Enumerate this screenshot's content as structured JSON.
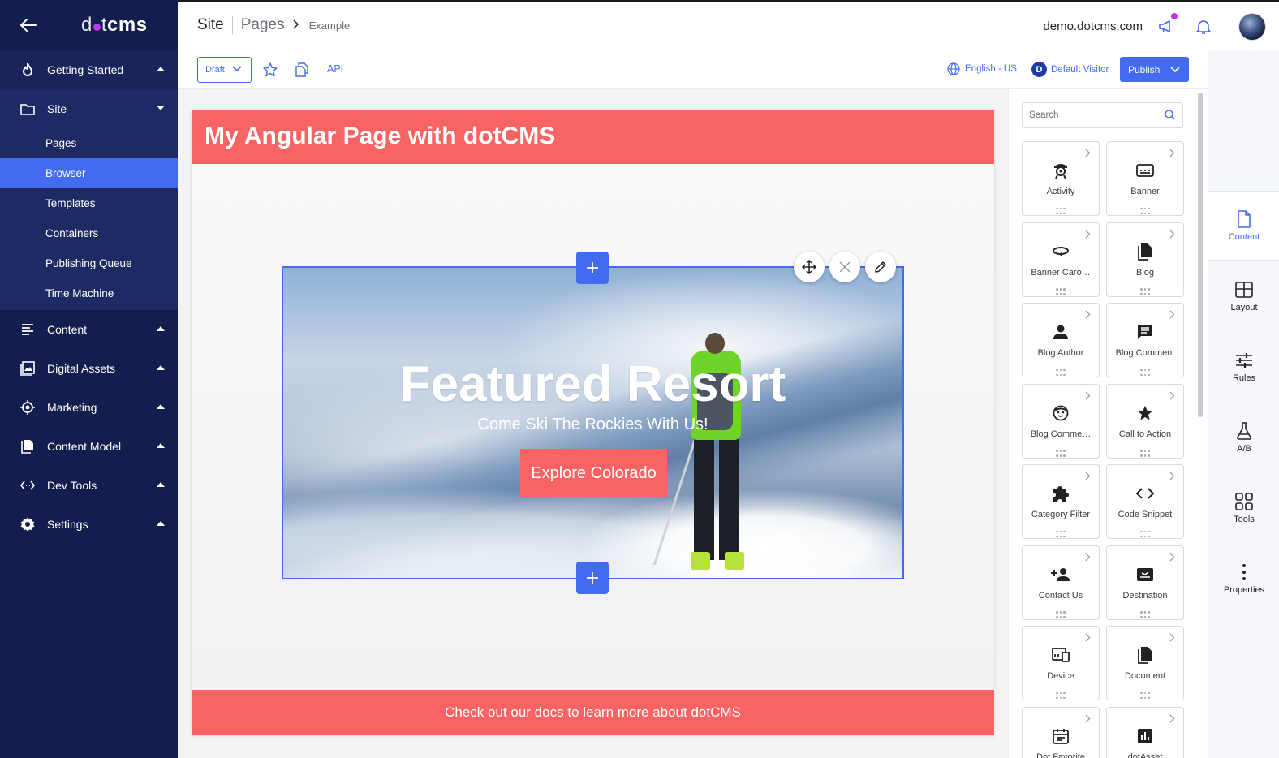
{
  "sidebar": {
    "logo_prefix": "d",
    "logo_dot_text": "t",
    "logo_cms": "cms",
    "groups": [
      {
        "label": "Getting Started",
        "icon": "flame-icon"
      },
      {
        "label": "Site",
        "icon": "folder-icon"
      },
      {
        "label": "Content",
        "icon": "content-lines-icon"
      },
      {
        "label": "Digital Assets",
        "icon": "image-icon"
      },
      {
        "label": "Marketing",
        "icon": "target-icon"
      },
      {
        "label": "Content Model",
        "icon": "documents-icon"
      },
      {
        "label": "Dev Tools",
        "icon": "code-arrows-icon"
      },
      {
        "label": "Settings",
        "icon": "gear-icon"
      }
    ],
    "site_items": [
      "Pages",
      "Browser",
      "Templates",
      "Containers",
      "Publishing Queue",
      "Time Machine"
    ],
    "active_item": "Browser"
  },
  "header": {
    "breadcrumb": [
      "Site",
      "Pages",
      "Example"
    ],
    "host": "demo.dotcms.com"
  },
  "toolbar": {
    "state": "Draft",
    "api_label": "API",
    "language": "English - US",
    "visitor_initial": "D",
    "visitor": "Default Visitor",
    "publish": "Publish"
  },
  "page": {
    "header_title": "My Angular Page with dotCMS",
    "hero_title": "Featured Resort",
    "hero_subtitle": "Come Ski The Rockies With Us!",
    "hero_button": "Explore Colorado",
    "footer_text": "Check out our docs to learn more about dotCMS"
  },
  "palette": {
    "search_placeholder": "Search",
    "items": [
      {
        "label": "Activity",
        "icon": "activity-icon"
      },
      {
        "label": "Banner",
        "icon": "banner-icon"
      },
      {
        "label": "Banner Carousel",
        "label_display": "Banner Caro…",
        "icon": "carousel-icon"
      },
      {
        "label": "Blog",
        "icon": "blog-icon"
      },
      {
        "label": "Blog Author",
        "icon": "person-icon"
      },
      {
        "label": "Blog Comment",
        "icon": "comment-icon"
      },
      {
        "label": "Blog Comment",
        "label_display": "Blog Comme…",
        "icon": "smiley-icon"
      },
      {
        "label": "Call to Action",
        "icon": "star-icon"
      },
      {
        "label": "Category Filter",
        "icon": "puzzle-icon"
      },
      {
        "label": "Code Snippet",
        "icon": "code-icon"
      },
      {
        "label": "Contact Us",
        "icon": "add-person-icon"
      },
      {
        "label": "Destination",
        "icon": "ticket-icon"
      },
      {
        "label": "Device",
        "icon": "devices-icon"
      },
      {
        "label": "Document",
        "icon": "document-icon"
      },
      {
        "label": "Dot Favorite",
        "label_display": "Dot Favorite",
        "icon": "calendar-icon"
      },
      {
        "label": "dotAsset",
        "label_display": "dotAsset",
        "icon": "chart-icon"
      }
    ]
  },
  "rail": [
    {
      "label": "Content",
      "icon": "document-outline-icon"
    },
    {
      "label": "Layout",
      "icon": "layout-grid-icon"
    },
    {
      "label": "Rules",
      "icon": "sliders-icon"
    },
    {
      "label": "A/B",
      "icon": "flask-icon"
    },
    {
      "label": "Tools",
      "icon": "tools-grid-icon"
    },
    {
      "label": "Properties",
      "icon": "kebab-icon"
    }
  ],
  "colors": {
    "sidebar_bg": "#131e4f",
    "accent": "#426bf0",
    "brand_red": "#fa6363",
    "notification_dot": "#c336e5"
  }
}
